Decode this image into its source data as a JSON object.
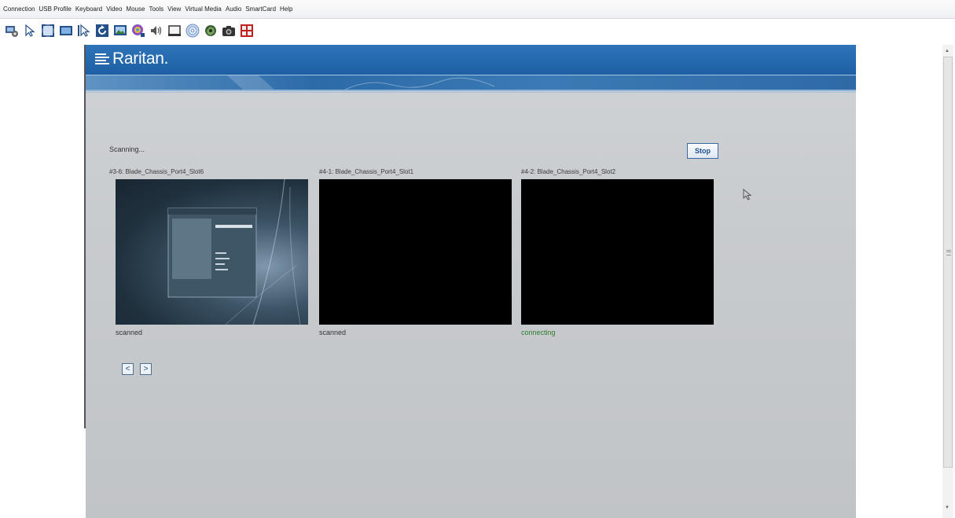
{
  "menu": [
    "Connection",
    "USB Profile",
    "Keyboard",
    "Video",
    "Mouse",
    "Tools",
    "View",
    "Virtual Media",
    "Audio",
    "SmartCard",
    "Help"
  ],
  "toolbar_icons": [
    "connection-properties-icon",
    "single-cursor-icon",
    "full-screen-icon",
    "screen-scale-icon",
    "mouse-sync-icon",
    "refresh-icon",
    "video-settings-icon",
    "color-settings-icon",
    "audio-icon",
    "keyboard-icon",
    "cd-rom-icon",
    "virtual-media-icon",
    "screenshot-icon",
    "port-scan-icon"
  ],
  "header": {
    "brand": "Raritan."
  },
  "scan": {
    "status": "Scanning...",
    "stop_label": "Stop",
    "tiles": [
      {
        "title": "#3-6: Blade_Chassis_Port4_Slot6",
        "status": "scanned"
      },
      {
        "title": "#4-1: Blade_Chassis_Port4_Slot1",
        "status": "scanned"
      },
      {
        "title": "#4-2: Blade_Chassis_Port4_Slot2",
        "status": "connecting"
      }
    ],
    "prev_label": "<",
    "next_label": ">"
  },
  "colors": {
    "banner": "#1c5fa4",
    "connecting": "#2e7d2e",
    "content_bg": "#c8cbce"
  }
}
